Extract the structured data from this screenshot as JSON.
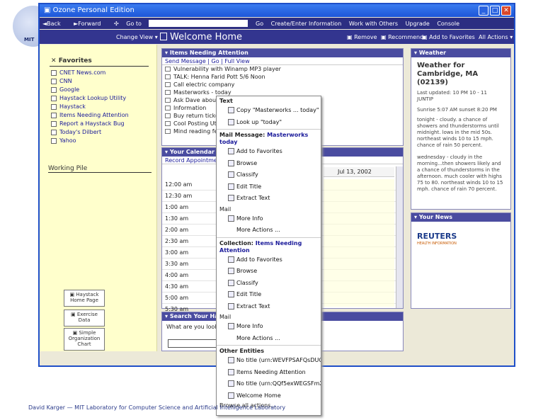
{
  "logo": {
    "text": "MIT"
  },
  "window": {
    "title": "Ozone Personal Edition"
  },
  "toolbar": {
    "back": "Back",
    "forward": "Forward",
    "goto": "Go to",
    "go": "Go",
    "create": "Create/Enter Information",
    "work": "Work with Others",
    "upgrade": "Upgrade",
    "console": "Console"
  },
  "subbar": {
    "change_view": "Change View",
    "title": "Welcome Home",
    "remove": "Remove",
    "recommend": "Recommend",
    "add_fav": "Add to Favorites",
    "all_actions": "All Actions"
  },
  "favorites": {
    "title": "Favorites",
    "items": [
      "CNET News.com",
      "CNN",
      "Google",
      "Haystack Lookup Utility",
      "Haystack",
      "Items Needing Attention",
      "Report a Haystack Bug",
      "Today's Dilbert",
      "Yahoo"
    ]
  },
  "working_pile": {
    "title": "Working Pile"
  },
  "pile_buttons": [
    "Haystack Home Page",
    "Exercise Data",
    "Simple Organization Chart"
  ],
  "attention": {
    "title": "Items Needing Attention",
    "tabs": [
      "Send Message",
      "Go",
      "Full View"
    ],
    "items": [
      "Vulnerability with Winamp MP3 player",
      "TALK: Henna Farid Pott 5/6 Noon",
      "Call electric company",
      "Masterworks - today",
      "Ask Dave about fi",
      "Information",
      "Buy return ticket",
      "Cool Posting Util",
      "Mind reading feat"
    ]
  },
  "calendar": {
    "title": "Your Calendar",
    "record": "Record Appointment",
    "date": "Jul 13, 2002",
    "times": [
      "12:00 am",
      "12:30 am",
      "1:00 am",
      "1:30 am",
      "2:00 am",
      "2:30 am",
      "3:00 am",
      "3:30 am",
      "4:00 am",
      "4:30 am",
      "5:00 am",
      "5:30 am"
    ]
  },
  "search": {
    "title": "Search Your Haystack",
    "prompt": "What are you looking for?"
  },
  "weather": {
    "title": "Weather",
    "heading": "Weather for Cambridge, MA (02139)",
    "updated": "Last updated: 10 PM 10 - 11 JUNTIP",
    "sun": "Sunrise 5:07 AM sunset 8:20 PM",
    "tonight": "tonight - cloudy. a chance of showers and thunderstorms until midnight. lows in the mid 50s. northeast winds 10 to 15 mph. chance of rain 50 percent.",
    "wednesday": "wednesday - cloudy in the morning...then showers likely and a chance of thunderstorms in the afternoon. much cooler with highs 75 to 80. northeast winds 10 to 15 mph. chance of rain 70 percent."
  },
  "news": {
    "title": "Your News",
    "brand": "REUTERS",
    "sub": "HEALTH INFORMATION"
  },
  "context_menu": {
    "text_header": "Text",
    "text_items": [
      "Copy \"Masterworks ... today\"",
      "Look up \"today\""
    ],
    "mail_header": "Mail Message: ",
    "mail_header_blue": "Masterworks today",
    "mail_items": [
      "Add to Favorites",
      "Browse",
      "Classify",
      "Edit Title",
      "Extract Text"
    ],
    "mail_sub": "Mail",
    "mail_sub_items": [
      "More Info",
      "More Actions ..."
    ],
    "coll_header": "Collection: ",
    "coll_header_blue": "Items Needing Attention",
    "coll_items": [
      "Add to Favorites",
      "Browse",
      "Classify",
      "Edit Title",
      "Extract Text"
    ],
    "coll_sub": "Mail",
    "coll_sub_items": [
      "More Info",
      "More Actions ..."
    ],
    "other_header": "Other Entities",
    "other_items": [
      "No title (urn:WEVFPSAFQsDUQB)",
      "Items Needing Attention",
      "No title (urn:QQf5exWEGSFmXL)",
      "Welcome Home"
    ],
    "browse_all": "Browse all actions..."
  },
  "footer": {
    "text": "David Karger — MIT Laboratory for Computer Science and Artificial Intelligence Laboratory"
  }
}
